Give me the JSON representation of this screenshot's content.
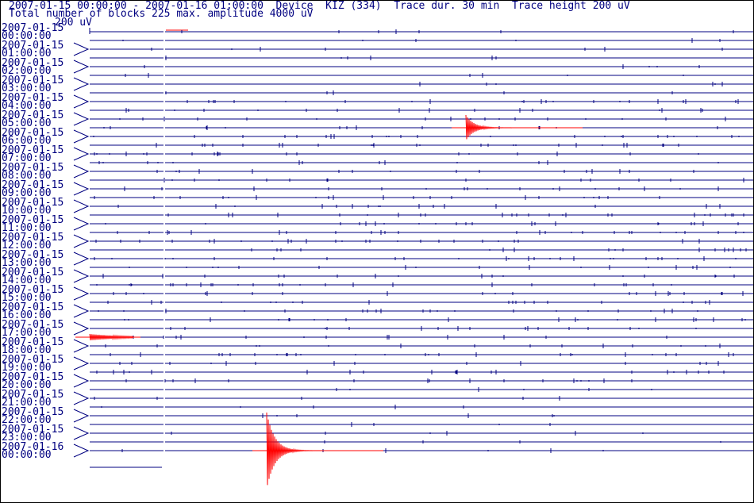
{
  "header": {
    "line1": "2007-01-15 00:00:00 - 2007-01-16 01:00:00  Device  KIZ (334)  Trace dur. 30 min  Trace height 200 uV",
    "line2": "Total number of blocks 225 max. amplitude 4000 uV"
  },
  "scale_label": "200 uV",
  "chart_data": {
    "type": "line",
    "title": "2007-01-15 00:00:00 - 2007-01-16 01:00:00  Device  KIZ (334)  Trace dur. 30 min  Trace height 200 uV",
    "subtitle": "Total number of blocks 225 max. amplitude 4000 uV",
    "device": "KIZ (334)",
    "start": "2007-01-15 00:00:00",
    "end": "2007-01-16 01:00:00",
    "trace_duration_min": 30,
    "trace_height_uV": 200,
    "total_blocks": 225,
    "max_amplitude_uV": 4000,
    "hour_labels": [
      {
        "date": "2007-01-15",
        "time": "00:00:00"
      },
      {
        "date": "2007-01-15",
        "time": "01:00:00"
      },
      {
        "date": "2007-01-15",
        "time": "02:00:00"
      },
      {
        "date": "2007-01-15",
        "time": "03:00:00"
      },
      {
        "date": "2007-01-15",
        "time": "04:00:00"
      },
      {
        "date": "2007-01-15",
        "time": "05:00:00"
      },
      {
        "date": "2007-01-15",
        "time": "06:00:00"
      },
      {
        "date": "2007-01-15",
        "time": "07:00:00"
      },
      {
        "date": "2007-01-15",
        "time": "08:00:00"
      },
      {
        "date": "2007-01-15",
        "time": "09:00:00"
      },
      {
        "date": "2007-01-15",
        "time": "10:00:00"
      },
      {
        "date": "2007-01-15",
        "time": "11:00:00"
      },
      {
        "date": "2007-01-15",
        "time": "12:00:00"
      },
      {
        "date": "2007-01-15",
        "time": "13:00:00"
      },
      {
        "date": "2007-01-15",
        "time": "14:00:00"
      },
      {
        "date": "2007-01-15",
        "time": "15:00:00"
      },
      {
        "date": "2007-01-15",
        "time": "16:00:00"
      },
      {
        "date": "2007-01-15",
        "time": "17:00:00"
      },
      {
        "date": "2007-01-15",
        "time": "18:00:00"
      },
      {
        "date": "2007-01-15",
        "time": "19:00:00"
      },
      {
        "date": "2007-01-15",
        "time": "20:00:00"
      },
      {
        "date": "2007-01-15",
        "time": "21:00:00"
      },
      {
        "date": "2007-01-15",
        "time": "22:00:00"
      },
      {
        "date": "2007-01-15",
        "time": "23:00:00"
      },
      {
        "date": "2007-01-16",
        "time": "00:00:00"
      }
    ],
    "events": [
      {
        "start": "2007-01-15 05:47",
        "end": "2007-01-15 05:52",
        "description": "event near 05:50",
        "color": "#ff0000"
      },
      {
        "start": "2007-01-15 17:30",
        "end": "2007-01-15 17:32",
        "description": "short burst near 17:30",
        "color": "#ff0000"
      },
      {
        "start": "2007-01-16 00:08",
        "end": "2007-01-16 00:13",
        "description": "largest event near 00:08",
        "color": "#ff0000"
      }
    ],
    "trace_color": "#000080",
    "event_color": "#ff0000",
    "grid": false
  }
}
